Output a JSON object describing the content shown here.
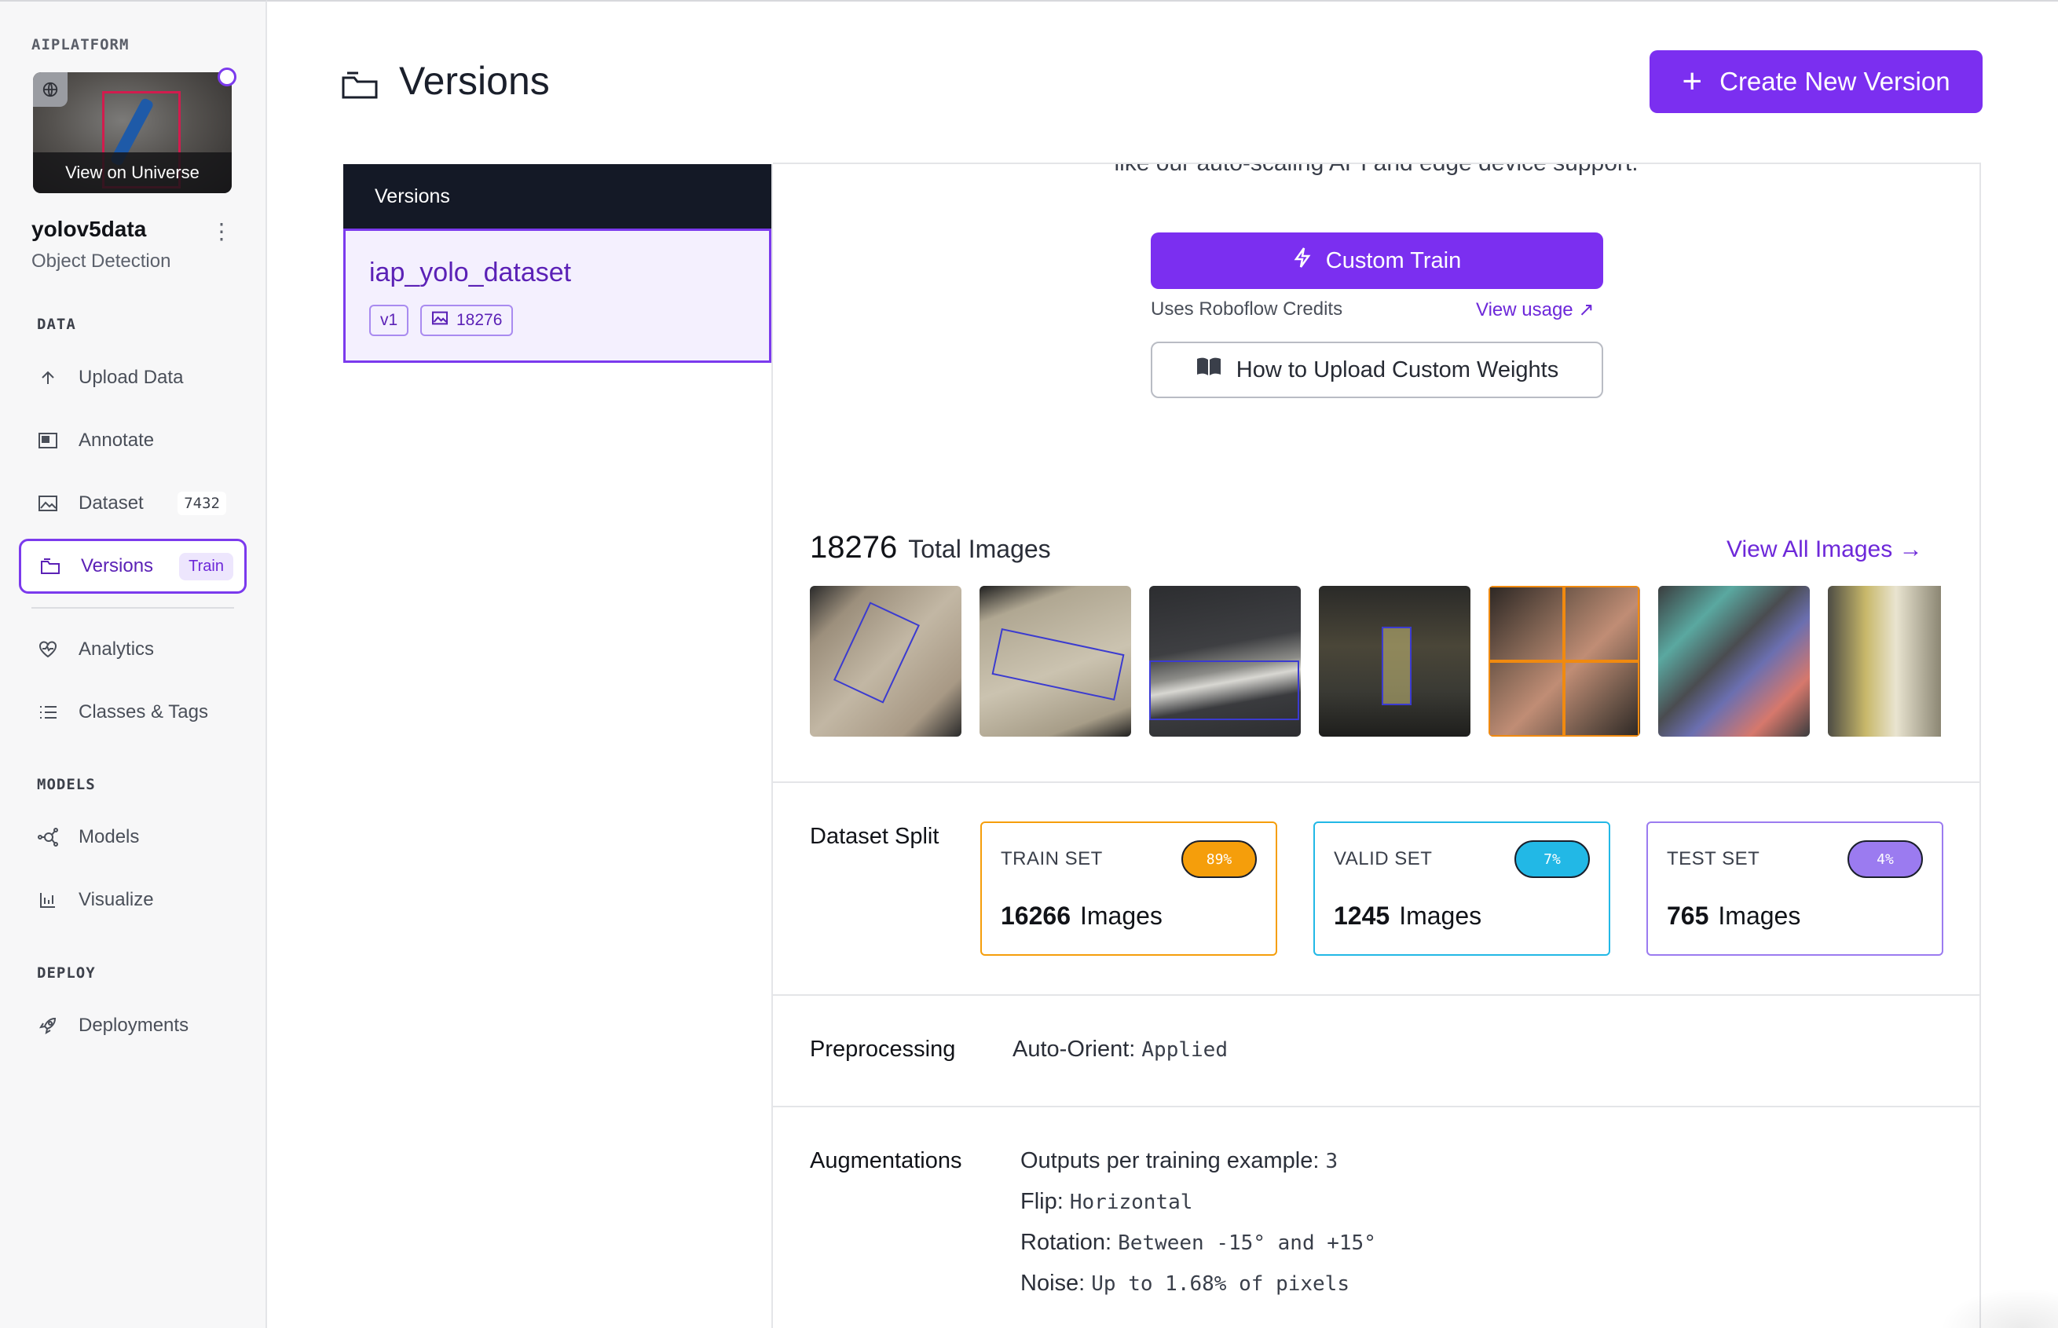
{
  "sidebar": {
    "workspace": "AIPLATFORM",
    "thumbnail_caption": "View on Universe",
    "project_name": "yolov5data",
    "project_type": "Object Detection",
    "sections": {
      "data": "DATA",
      "models": "MODELS",
      "deploy": "DEPLOY"
    },
    "items": {
      "upload": "Upload Data",
      "annotate": "Annotate",
      "dataset": "Dataset",
      "dataset_count": "7432",
      "versions": "Versions",
      "versions_pill": "Train",
      "analytics": "Analytics",
      "classes": "Classes & Tags",
      "models": "Models",
      "visualize": "Visualize",
      "deployments": "Deployments"
    }
  },
  "header": {
    "title": "Versions",
    "create_button": "Create New Version"
  },
  "versions_panel": {
    "heading": "Versions",
    "items": [
      {
        "name": "iap_yolo_dataset",
        "version": "v1",
        "images": "18276"
      }
    ]
  },
  "detail": {
    "cut_text": "like our auto-scaling API and edge device support.",
    "custom_train": "Custom Train",
    "credits_note": "Uses Roboflow Credits",
    "view_usage": "View usage",
    "weights_button": "How to Upload Custom Weights",
    "total_images_count": "18276",
    "total_images_label": "Total Images",
    "view_all": "View All Images",
    "split": {
      "label": "Dataset Split",
      "train": {
        "title": "TRAIN SET",
        "pct": "89%",
        "count": "16266",
        "unit": "Images",
        "color": "#f59e0b"
      },
      "valid": {
        "title": "VALID SET",
        "pct": "7%",
        "count": "1245",
        "unit": "Images",
        "color": "#22b8e6"
      },
      "test": {
        "title": "TEST SET",
        "pct": "4%",
        "count": "765",
        "unit": "Images",
        "color": "#9b7bf0"
      }
    },
    "preprocessing": {
      "label": "Preprocessing",
      "key": "Auto-Orient:",
      "value": "Applied"
    },
    "augmentations": {
      "label": "Augmentations",
      "items": [
        {
          "key": "Outputs per training example:",
          "value": "3"
        },
        {
          "key": "Flip:",
          "value": "Horizontal"
        },
        {
          "key": "Rotation:",
          "value": "Between -15° and +15°"
        },
        {
          "key": "Noise:",
          "value": "Up to 1.68% of pixels"
        }
      ]
    }
  },
  "colors": {
    "accent": "#7b2ff0",
    "accent_text": "#6d28d9",
    "dark_header": "#141926"
  },
  "icons": {
    "upload": "arrow-up-icon",
    "annotate": "annotate-icon",
    "dataset": "image-icon",
    "versions": "folder-icon",
    "analytics": "heart-pulse-icon",
    "classes": "list-icon",
    "models": "network-icon",
    "visualize": "bar-chart-icon",
    "deployments": "rocket-icon"
  }
}
